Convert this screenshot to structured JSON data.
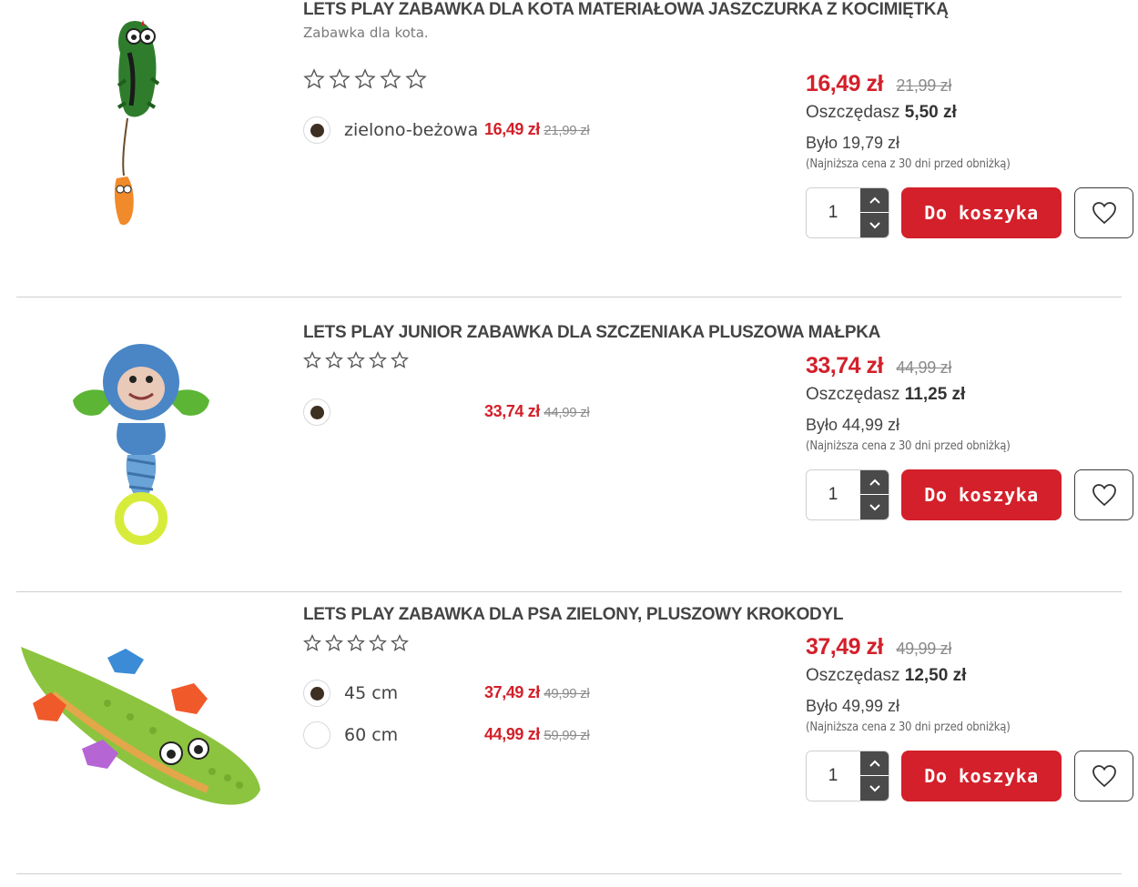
{
  "products": [
    {
      "title": "LETS PLAY ZABAWKA DLA KOTA MATERIAŁOWA JASZCZURKA Z KOCIMIĘTKĄ",
      "subtitle": "Zabawka dla kota.",
      "rating_stars": 5,
      "rating_filled": 0,
      "variants": [
        {
          "name": "zielono-beżowa",
          "price": "16,49 zł",
          "old_price": "21,99 zł",
          "selected": true
        }
      ],
      "price": "16,49 zł",
      "old_price": "21,99 zł",
      "save_label": "Oszczędasz",
      "save_amount": "5,50 zł",
      "was": "Było 19,79 zł",
      "lowest_note": "(Najniższa cena z 30 dni przed obniżką)",
      "quantity": "1",
      "cart_label": "Do koszyka",
      "icon_favorite": "heart-icon"
    },
    {
      "title": "LETS PLAY JUNIOR ZABAWKA DLA SZCZENIAKA PLUSZOWA MAŁPKA",
      "rating_stars": 5,
      "rating_filled": 0,
      "variants": [
        {
          "name": "",
          "price": "33,74 zł",
          "old_price": "44,99 zł",
          "selected": true
        }
      ],
      "price": "33,74 zł",
      "old_price": "44,99 zł",
      "save_label": "Oszczędasz",
      "save_amount": "11,25 zł",
      "was": "Było 44,99 zł",
      "lowest_note": "(Najniższa cena z 30 dni przed obniżką)",
      "quantity": "1",
      "cart_label": "Do koszyka",
      "icon_favorite": "heart-icon"
    },
    {
      "title": "LETS PLAY ZABAWKA DLA PSA ZIELONY, PLUSZOWY KROKODYL",
      "rating_stars": 5,
      "rating_filled": 0,
      "variants": [
        {
          "name": "45 cm",
          "price": "37,49 zł",
          "old_price": "49,99 zł",
          "selected": true
        },
        {
          "name": "60 cm",
          "price": "44,99 zł",
          "old_price": "59,99 zł",
          "selected": false
        }
      ],
      "price": "37,49 zł",
      "old_price": "49,99 zł",
      "save_label": "Oszczędasz",
      "save_amount": "12,50 zł",
      "was": "Było 49,99 zł",
      "lowest_note": "(Najniższa cena z 30 dni przed obniżką)",
      "quantity": "1",
      "cart_label": "Do koszyka",
      "icon_favorite": "heart-icon"
    }
  ],
  "colors": {
    "accent": "#d3202a",
    "text": "#444444",
    "old_price": "#8a8a8a",
    "stepper": "#4a4a4a",
    "divider": "#cfcfcf",
    "variant_dot": "#3d2f22"
  }
}
